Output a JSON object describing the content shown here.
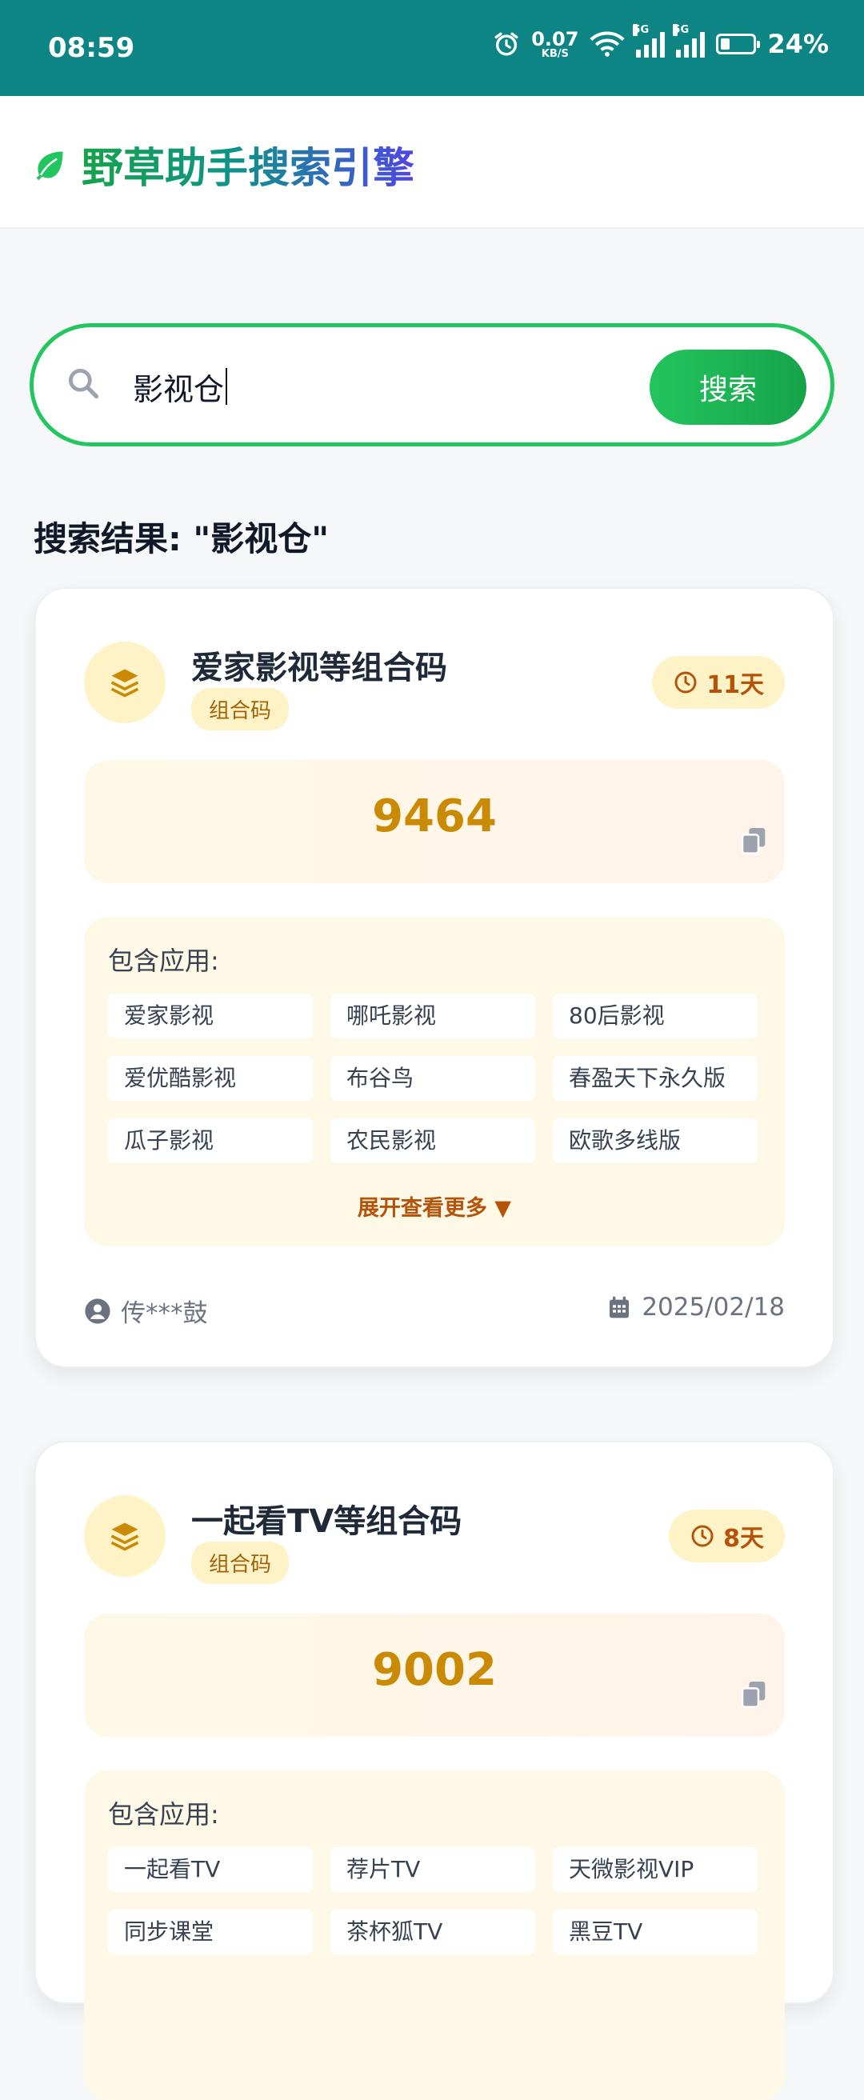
{
  "status_bar": {
    "time": "08:59",
    "net_speed_value": "0.07",
    "net_speed_unit": "KB/S",
    "signal1_label": "5G",
    "signal2_label": "5G",
    "battery": "24%"
  },
  "header": {
    "brand_title": "野草助手搜索引擎",
    "icon": "leaf-icon"
  },
  "search": {
    "value": "影视仓",
    "button_label": "搜索",
    "icon": "search-icon"
  },
  "results": {
    "title": "搜索结果: \"影视仓\"",
    "cards": [
      {
        "title": "爱家影视等组合码",
        "tag": "组合码",
        "days": "11天",
        "code": "9464",
        "apps_label": "包含应用:",
        "apps": [
          "爱家影视",
          "哪吒影视",
          "80后影视",
          "爱优酷影视",
          "布谷鸟",
          "春盈天下永久版",
          "瓜子影视",
          "农民影视",
          "欧歌多线版"
        ],
        "expand_label": "展开查看更多 ▼",
        "author": "传***鼓",
        "date": "2025/02/18"
      },
      {
        "title": "一起看TV等组合码",
        "tag": "组合码",
        "days": "8天",
        "code": "9002",
        "apps_label": "包含应用:",
        "apps": [
          "一起看TV",
          "荐片TV",
          "天微影视VIP",
          "同步课堂",
          "茶杯狐TV",
          "黑豆TV"
        ]
      }
    ]
  },
  "colors": {
    "status_bar": "#0d8585",
    "accent_green": "#22c55e",
    "code_gold": "#ca8a04",
    "tag_bg": "#fef3c7"
  }
}
